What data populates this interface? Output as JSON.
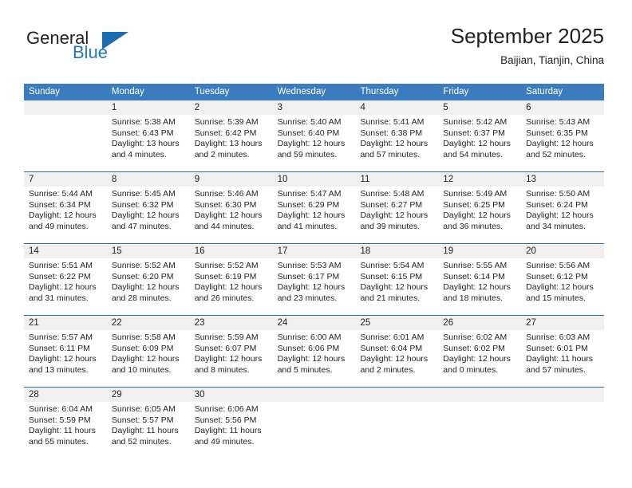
{
  "brand": {
    "name_part1": "General",
    "name_part2": "Blue",
    "accent_color": "#1c79c0",
    "triangle_color": "#1c6cb0"
  },
  "header": {
    "title": "September 2025",
    "location": "Baijian, Tianjin, China"
  },
  "theme": {
    "header_row_bg": "#3a7cbe",
    "week_divider": "#2e6da4",
    "daynum_band_bg": "#f0f0f0",
    "text_color": "#231f20"
  },
  "weekdays": [
    "Sunday",
    "Monday",
    "Tuesday",
    "Wednesday",
    "Thursday",
    "Friday",
    "Saturday"
  ],
  "weeks": [
    {
      "days": [
        {
          "num": "",
          "empty": true,
          "lines": []
        },
        {
          "num": "1",
          "lines": [
            "Sunrise: 5:38 AM",
            "Sunset: 6:43 PM",
            "Daylight: 13 hours",
            "and 4 minutes."
          ]
        },
        {
          "num": "2",
          "lines": [
            "Sunrise: 5:39 AM",
            "Sunset: 6:42 PM",
            "Daylight: 13 hours",
            "and 2 minutes."
          ]
        },
        {
          "num": "3",
          "lines": [
            "Sunrise: 5:40 AM",
            "Sunset: 6:40 PM",
            "Daylight: 12 hours",
            "and 59 minutes."
          ]
        },
        {
          "num": "4",
          "lines": [
            "Sunrise: 5:41 AM",
            "Sunset: 6:38 PM",
            "Daylight: 12 hours",
            "and 57 minutes."
          ]
        },
        {
          "num": "5",
          "lines": [
            "Sunrise: 5:42 AM",
            "Sunset: 6:37 PM",
            "Daylight: 12 hours",
            "and 54 minutes."
          ]
        },
        {
          "num": "6",
          "lines": [
            "Sunrise: 5:43 AM",
            "Sunset: 6:35 PM",
            "Daylight: 12 hours",
            "and 52 minutes."
          ]
        }
      ]
    },
    {
      "days": [
        {
          "num": "7",
          "lines": [
            "Sunrise: 5:44 AM",
            "Sunset: 6:34 PM",
            "Daylight: 12 hours",
            "and 49 minutes."
          ]
        },
        {
          "num": "8",
          "lines": [
            "Sunrise: 5:45 AM",
            "Sunset: 6:32 PM",
            "Daylight: 12 hours",
            "and 47 minutes."
          ]
        },
        {
          "num": "9",
          "lines": [
            "Sunrise: 5:46 AM",
            "Sunset: 6:30 PM",
            "Daylight: 12 hours",
            "and 44 minutes."
          ]
        },
        {
          "num": "10",
          "lines": [
            "Sunrise: 5:47 AM",
            "Sunset: 6:29 PM",
            "Daylight: 12 hours",
            "and 41 minutes."
          ]
        },
        {
          "num": "11",
          "lines": [
            "Sunrise: 5:48 AM",
            "Sunset: 6:27 PM",
            "Daylight: 12 hours",
            "and 39 minutes."
          ]
        },
        {
          "num": "12",
          "lines": [
            "Sunrise: 5:49 AM",
            "Sunset: 6:25 PM",
            "Daylight: 12 hours",
            "and 36 minutes."
          ]
        },
        {
          "num": "13",
          "lines": [
            "Sunrise: 5:50 AM",
            "Sunset: 6:24 PM",
            "Daylight: 12 hours",
            "and 34 minutes."
          ]
        }
      ]
    },
    {
      "days": [
        {
          "num": "14",
          "lines": [
            "Sunrise: 5:51 AM",
            "Sunset: 6:22 PM",
            "Daylight: 12 hours",
            "and 31 minutes."
          ]
        },
        {
          "num": "15",
          "lines": [
            "Sunrise: 5:52 AM",
            "Sunset: 6:20 PM",
            "Daylight: 12 hours",
            "and 28 minutes."
          ]
        },
        {
          "num": "16",
          "lines": [
            "Sunrise: 5:52 AM",
            "Sunset: 6:19 PM",
            "Daylight: 12 hours",
            "and 26 minutes."
          ]
        },
        {
          "num": "17",
          "lines": [
            "Sunrise: 5:53 AM",
            "Sunset: 6:17 PM",
            "Daylight: 12 hours",
            "and 23 minutes."
          ]
        },
        {
          "num": "18",
          "lines": [
            "Sunrise: 5:54 AM",
            "Sunset: 6:15 PM",
            "Daylight: 12 hours",
            "and 21 minutes."
          ]
        },
        {
          "num": "19",
          "lines": [
            "Sunrise: 5:55 AM",
            "Sunset: 6:14 PM",
            "Daylight: 12 hours",
            "and 18 minutes."
          ]
        },
        {
          "num": "20",
          "lines": [
            "Sunrise: 5:56 AM",
            "Sunset: 6:12 PM",
            "Daylight: 12 hours",
            "and 15 minutes."
          ]
        }
      ]
    },
    {
      "days": [
        {
          "num": "21",
          "lines": [
            "Sunrise: 5:57 AM",
            "Sunset: 6:11 PM",
            "Daylight: 12 hours",
            "and 13 minutes."
          ]
        },
        {
          "num": "22",
          "lines": [
            "Sunrise: 5:58 AM",
            "Sunset: 6:09 PM",
            "Daylight: 12 hours",
            "and 10 minutes."
          ]
        },
        {
          "num": "23",
          "lines": [
            "Sunrise: 5:59 AM",
            "Sunset: 6:07 PM",
            "Daylight: 12 hours",
            "and 8 minutes."
          ]
        },
        {
          "num": "24",
          "lines": [
            "Sunrise: 6:00 AM",
            "Sunset: 6:06 PM",
            "Daylight: 12 hours",
            "and 5 minutes."
          ]
        },
        {
          "num": "25",
          "lines": [
            "Sunrise: 6:01 AM",
            "Sunset: 6:04 PM",
            "Daylight: 12 hours",
            "and 2 minutes."
          ]
        },
        {
          "num": "26",
          "lines": [
            "Sunrise: 6:02 AM",
            "Sunset: 6:02 PM",
            "Daylight: 12 hours",
            "and 0 minutes."
          ]
        },
        {
          "num": "27",
          "lines": [
            "Sunrise: 6:03 AM",
            "Sunset: 6:01 PM",
            "Daylight: 11 hours",
            "and 57 minutes."
          ]
        }
      ]
    },
    {
      "days": [
        {
          "num": "28",
          "lines": [
            "Sunrise: 6:04 AM",
            "Sunset: 5:59 PM",
            "Daylight: 11 hours",
            "and 55 minutes."
          ]
        },
        {
          "num": "29",
          "lines": [
            "Sunrise: 6:05 AM",
            "Sunset: 5:57 PM",
            "Daylight: 11 hours",
            "and 52 minutes."
          ]
        },
        {
          "num": "30",
          "lines": [
            "Sunrise: 6:06 AM",
            "Sunset: 5:56 PM",
            "Daylight: 11 hours",
            "and 49 minutes."
          ]
        },
        {
          "num": "",
          "empty": true,
          "lines": []
        },
        {
          "num": "",
          "empty": true,
          "lines": []
        },
        {
          "num": "",
          "empty": true,
          "lines": []
        },
        {
          "num": "",
          "empty": true,
          "lines": []
        }
      ]
    }
  ]
}
